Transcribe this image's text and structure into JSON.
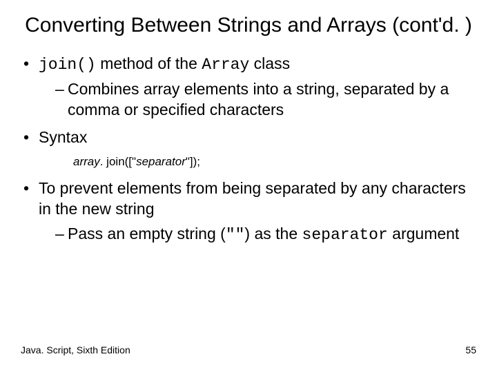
{
  "title": "Converting Between Strings and Arrays (cont'd. )",
  "b1_prefix": "join()",
  "b1_mid": " method of the ",
  "b1_class": "Array",
  "b1_suffix": " class",
  "b1_sub1": "Combines array elements into a string, separated by a comma or specified characters",
  "b2": "Syntax",
  "syntax_ital1": "array",
  "syntax_plain1": ". join([\"",
  "syntax_ital2": "separator",
  "syntax_plain2": "\"]);",
  "b3": "To prevent elements from being separated by any characters in the new string",
  "b3_sub_pre": "Pass an empty string (",
  "b3_sub_code": "\"\"",
  "b3_sub_mid": ") as the ",
  "b3_sub_sep": "separator",
  "b3_sub_post": " argument",
  "footer_left": "Java. Script, Sixth Edition",
  "footer_right": "55"
}
